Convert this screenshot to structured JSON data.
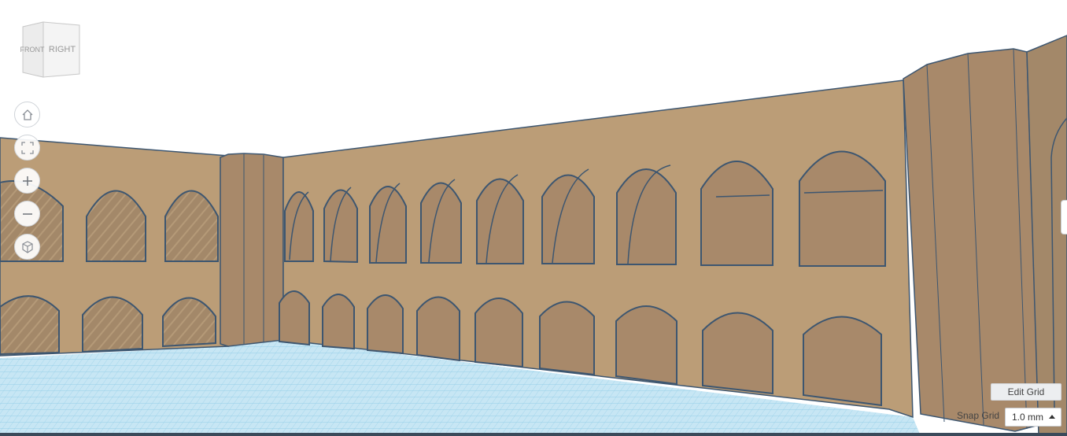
{
  "viewcube": {
    "front_label": "FRONT",
    "right_label": "RIGHT"
  },
  "controls": {
    "home": "home-icon",
    "fit": "fit-view-icon",
    "zoom_in": "plus-icon",
    "zoom_out": "minus-icon",
    "projection": "perspective-cube-icon"
  },
  "grid": {
    "edit_label": "Edit Grid",
    "snap_label": "Snap Grid",
    "snap_value": "1.0 mm"
  },
  "colors": {
    "wall": "#bb9d77",
    "wall_shade": "#a8896a",
    "outline": "#3d5670",
    "grid_plane": "#c7e6f4",
    "grid_line": "#8ecbe6"
  }
}
